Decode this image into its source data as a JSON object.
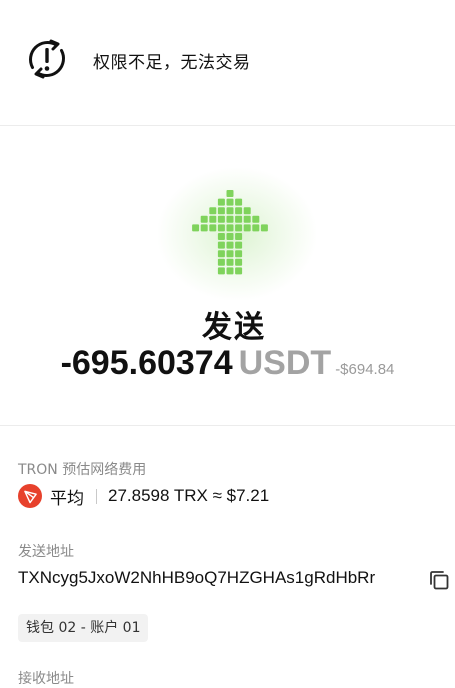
{
  "warning": {
    "icon": "alert-cycle-icon",
    "text": "权限不足，无法交易"
  },
  "transaction": {
    "arrow_icon": "send-arrow-icon",
    "arrow_color": "#7fd35c",
    "action": "发送",
    "amount": "-695.60374",
    "currency": "USDT",
    "fiat_value": "-$694.84"
  },
  "fee": {
    "label": "TRON 预估网络费用",
    "network_icon": "tron-logo-icon",
    "network_color": "#e7412c",
    "speed": "平均",
    "value": "27.8598 TRX ≈ $7.21"
  },
  "sender": {
    "label": "发送地址",
    "address": "TXNcyg5JxoW2NhHB9oQ7HZGHAs1gRdHbRr",
    "copy_icon": "copy-icon",
    "wallet_tag": "钱包 02 - 账户 01"
  },
  "receiver": {
    "label": "接收地址"
  }
}
